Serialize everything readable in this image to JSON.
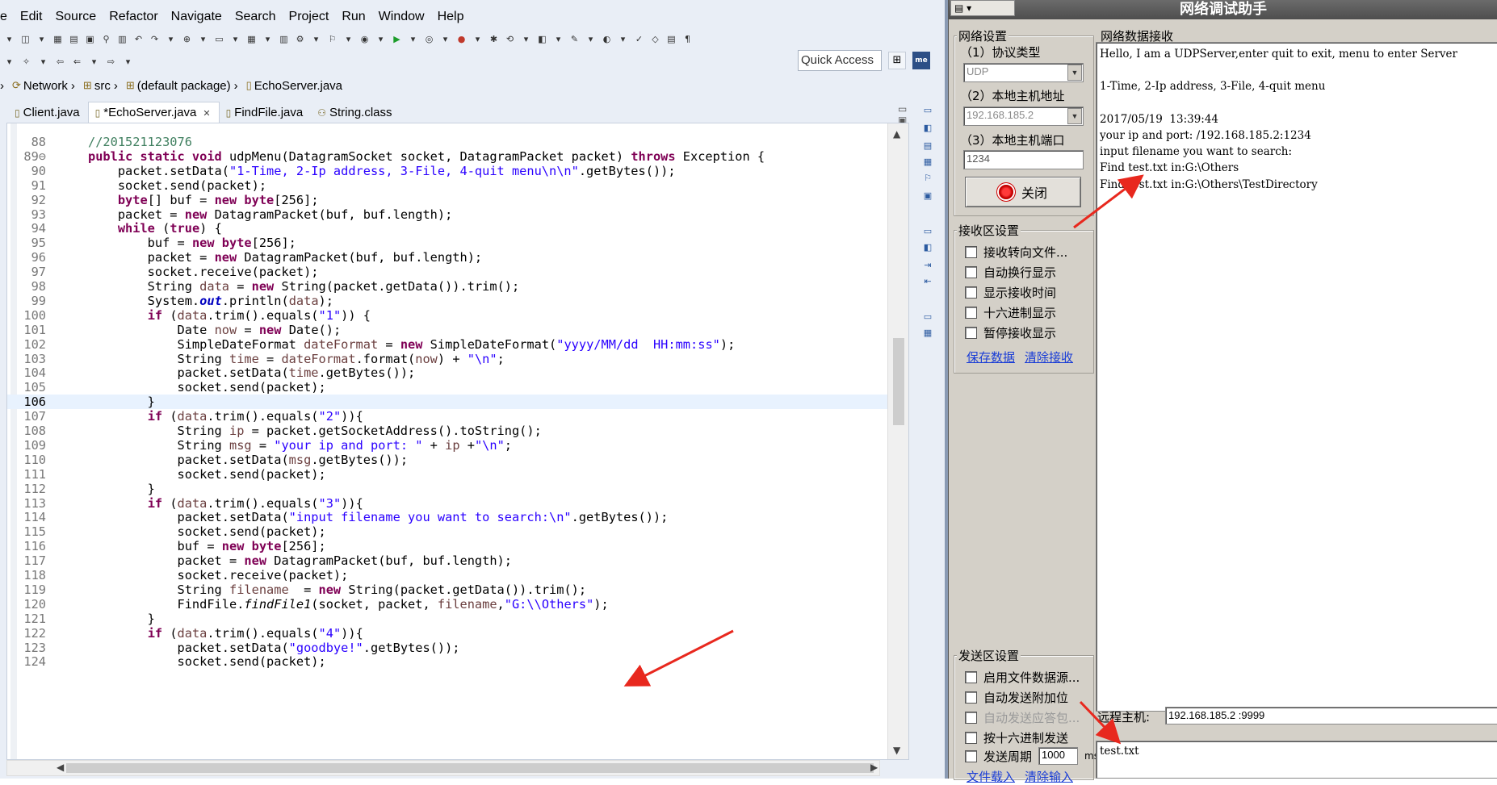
{
  "eclipse": {
    "menu": [
      "e",
      "Edit",
      "Source",
      "Refactor",
      "Navigate",
      "Search",
      "Project",
      "Run",
      "Window",
      "Help"
    ],
    "quick_access": "Quick Access",
    "breadcrumb": [
      "Network",
      "src",
      "(default package)",
      "EchoServer.java"
    ],
    "tabs": [
      {
        "label": "Client.java",
        "active": false
      },
      {
        "label": "*EchoServer.java",
        "active": true
      },
      {
        "label": "FindFile.java",
        "active": false
      },
      {
        "label": "String.class",
        "active": false
      }
    ],
    "code_lines": [
      {
        "num": "88",
        "html": "<span class=\"cm\">//201521123076</span>"
      },
      {
        "num": "89⊖",
        "html": "<span class=\"kw\">public static void</span> udpMenu(DatagramSocket socket, DatagramPacket packet) <span class=\"kw\">throws</span> Exception {"
      },
      {
        "num": "90",
        "html": "    packet.setData(<span class=\"str\">\"1-Time, 2-Ip address, 3-File, 4-quit menu\\n\\n\"</span>.getBytes());"
      },
      {
        "num": "91",
        "html": "    socket.send(packet);"
      },
      {
        "num": "92",
        "html": "    <span class=\"kw\">byte</span>[] buf = <span class=\"kw\">new byte</span>[256];"
      },
      {
        "num": "93",
        "html": "    packet = <span class=\"kw\">new</span> DatagramPacket(buf, buf.length);"
      },
      {
        "num": "94",
        "html": "    <span class=\"kw\">while</span> (<span class=\"kw\">true</span>) {"
      },
      {
        "num": "95",
        "html": "        buf = <span class=\"kw\">new byte</span>[256];"
      },
      {
        "num": "96",
        "html": "        packet = <span class=\"kw\">new</span> DatagramPacket(buf, buf.length);"
      },
      {
        "num": "97",
        "html": "        socket.receive(packet);"
      },
      {
        "num": "98",
        "html": "        String <span class=\"vr\">data</span> = <span class=\"kw\">new</span> String(packet.getData()).trim();"
      },
      {
        "num": "99",
        "html": "        System.<span class=\"fld it\">out</span>.println(<span class=\"vr\">data</span>);"
      },
      {
        "num": "100",
        "html": "        <span class=\"kw\">if</span> (<span class=\"vr\">data</span>.trim().equals(<span class=\"str\">\"1\"</span>)) {"
      },
      {
        "num": "101",
        "html": "            Date <span class=\"vr\">now</span> = <span class=\"kw\">new</span> Date();"
      },
      {
        "num": "102",
        "html": "            SimpleDateFormat <span class=\"vr\">dateFormat</span> = <span class=\"kw\">new</span> SimpleDateFormat(<span class=\"str\">\"yyyy/MM/dd  HH:mm:ss\"</span>);"
      },
      {
        "num": "103",
        "html": "            String <span class=\"vr\">time</span> = <span class=\"vr\">dateFormat</span>.format(<span class=\"vr\">now</span>) + <span class=\"str\">\"\\n\"</span>;"
      },
      {
        "num": "104",
        "html": "            packet.setData(<span class=\"vr\">time</span>.getBytes());"
      },
      {
        "num": "105",
        "html": "            socket.send(packet);"
      },
      {
        "num": "106",
        "html": "        }"
      },
      {
        "num": "107",
        "html": "        <span class=\"kw\">if</span> (<span class=\"vr\">data</span>.trim().equals(<span class=\"str\">\"2\"</span>)){"
      },
      {
        "num": "108",
        "html": "            String <span class=\"vr\">ip</span> = packet.getSocketAddress().toString();"
      },
      {
        "num": "109",
        "html": "            String <span class=\"vr\">msg</span> = <span class=\"str\">\"your ip and port: \"</span> + <span class=\"vr\">ip</span> +<span class=\"str\">\"\\n\"</span>;"
      },
      {
        "num": "110",
        "html": "            packet.setData(<span class=\"vr\">msg</span>.getBytes());"
      },
      {
        "num": "111",
        "html": "            socket.send(packet);"
      },
      {
        "num": "112",
        "html": "        }"
      },
      {
        "num": "113",
        "html": "        <span class=\"kw\">if</span> (<span class=\"vr\">data</span>.trim().equals(<span class=\"str\">\"3\"</span>)){"
      },
      {
        "num": "114",
        "html": "            packet.setData(<span class=\"str\">\"input filename you want to search:\\n\"</span>.getBytes());"
      },
      {
        "num": "115",
        "html": "            socket.send(packet);"
      },
      {
        "num": "116",
        "html": "            buf = <span class=\"kw\">new byte</span>[256];"
      },
      {
        "num": "117",
        "html": "            packet = <span class=\"kw\">new</span> DatagramPacket(buf, buf.length);"
      },
      {
        "num": "118",
        "html": "            socket.receive(packet);"
      },
      {
        "num": "119",
        "html": "            String <span class=\"vr\">filename</span>  = <span class=\"kw\">new</span> String(packet.getData()).trim();"
      },
      {
        "num": "120",
        "html": "            FindFile.<span class=\"it\">findFile1</span>(socket, packet, <span class=\"vr\">filename</span>,<span class=\"str\">\"G:\\\\Others\"</span>);"
      },
      {
        "num": "121",
        "html": "        }"
      },
      {
        "num": "122",
        "html": "        <span class=\"kw\">if</span> (<span class=\"vr\">data</span>.trim().equals(<span class=\"str\">\"4\"</span>)){"
      },
      {
        "num": "123",
        "html": "            packet.setData(<span class=\"str\">\"goodbye!\"</span>.getBytes());"
      },
      {
        "num": "124",
        "html": "            socket.send(packet);"
      }
    ]
  },
  "netassist": {
    "title": "网络调试助手",
    "net_settings": "网络设置",
    "protocol_label": "（1）协议类型",
    "protocol_value": "UDP",
    "local_ip_label": "（2）本地主机地址",
    "local_ip_value": "192.168.185.2",
    "local_port_label": "（3）本地主机端口",
    "local_port_value": "1234",
    "close_button": "关闭",
    "recv_settings": "接收区设置",
    "recv_options": [
      "接收转向文件...",
      "自动换行显示",
      "显示接收时间",
      "十六进制显示",
      "暂停接收显示"
    ],
    "save_data": "保存数据",
    "clear_recv": "清除接收",
    "recv_area_title": "网络数据接收",
    "recv_lines": [
      "Hello, I am a UDPServer,enter quit to exit, menu to enter Server",
      "",
      "1-Time, 2-Ip address, 3-File, 4-quit menu",
      "",
      "2017/05/19  13:39:44",
      "your ip and port: /192.168.185.2:1234",
      "input filename you want to search:",
      "Find test.txt in:G:\\Others",
      "Find test.txt in:G:\\Others\\TestDirectory"
    ],
    "send_settings": "发送区设置",
    "send_options": [
      {
        "label": "启用文件数据源...",
        "disabled": false
      },
      {
        "label": "自动发送附加位",
        "disabled": false
      },
      {
        "label": "自动发送应答包...",
        "disabled": true
      },
      {
        "label": "按十六进制发送",
        "disabled": false
      }
    ],
    "send_period_label": "发送周期",
    "send_period_value": "1000",
    "send_period_unit": "ms",
    "file_load": "文件载入",
    "clear_input": "清除输入",
    "remote_host_label": "远程主机:",
    "remote_host_value": "192.168.185.2 :9999",
    "send_text": "test.txt"
  }
}
